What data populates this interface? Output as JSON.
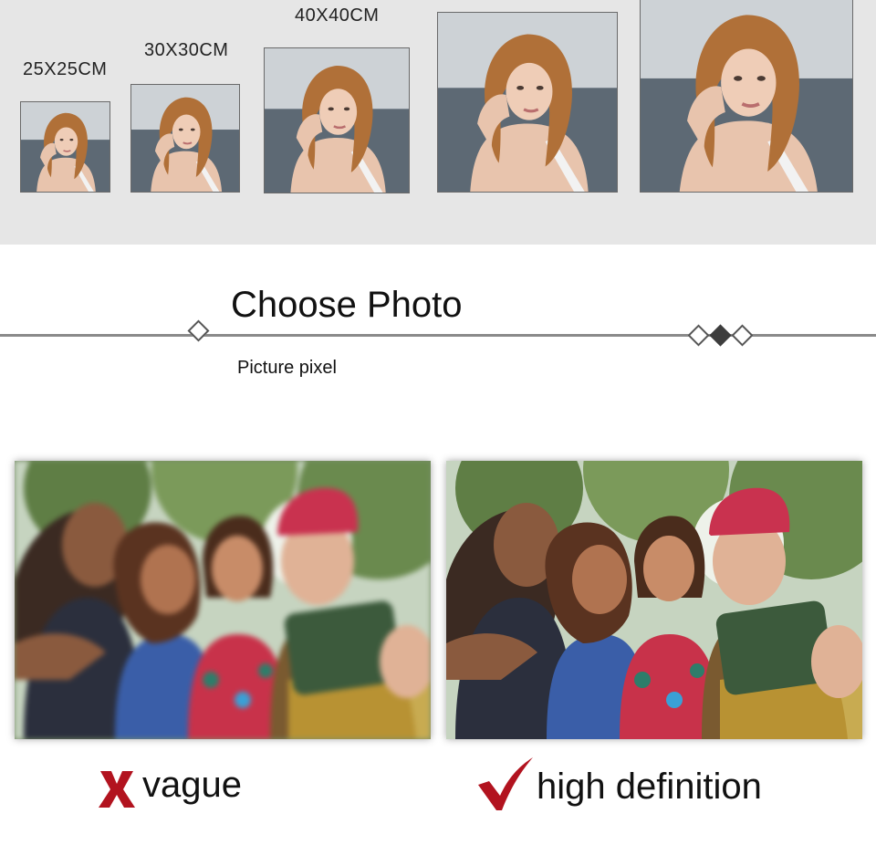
{
  "sizes": {
    "labels": [
      "25X25CM",
      "30X30CM",
      "40X40CM"
    ]
  },
  "heading": {
    "title": "Choose Photo",
    "subtitle": "Picture pixel"
  },
  "comparison": {
    "vague_label": "vague",
    "hd_label": "high definition",
    "x_icon": "x-mark-icon",
    "check_icon": "checkmark-icon",
    "mark_color": "#b2131f"
  }
}
